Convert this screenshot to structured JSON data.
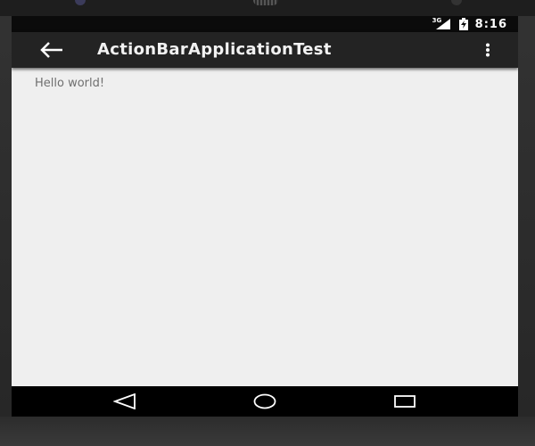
{
  "status_bar": {
    "network_label": "3G",
    "time": "8:16",
    "icons": [
      "signal-icon",
      "battery-icon"
    ]
  },
  "action_bar": {
    "title": "ActionBarApplicationTest",
    "up_icon": "back-arrow-icon",
    "overflow_icon": "overflow-menu-icon"
  },
  "content": {
    "text": "Hello world!"
  },
  "nav_bar": {
    "icons": [
      "nav-back-icon",
      "nav-home-icon",
      "nav-recents-icon"
    ]
  },
  "colors": {
    "action_bar_bg": "#232323",
    "content_bg": "#efefef",
    "text_color": "#6f6f6f"
  }
}
